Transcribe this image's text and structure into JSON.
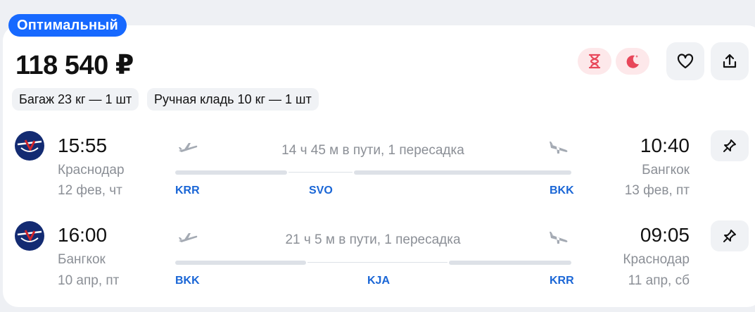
{
  "badge": "Оптимальный",
  "price": "118 540 ₽",
  "baggage": [
    "Багаж 23 кг — 1 шт",
    "Ручная кладь 10 кг — 1 шт"
  ],
  "icons": {
    "hourglass": "hourglass-icon",
    "night": "moon-icon",
    "favorite": "heart-icon",
    "share": "share-icon",
    "pin": "pin-icon",
    "airline": "airline-logo"
  },
  "colors": {
    "accent": "#1769ff",
    "airport_code": "#1a66d6",
    "warning_bg": "#fde8ea",
    "warning_icon": "#e8475a",
    "airline_logo": "#132b72"
  },
  "flights": [
    {
      "dep_time": "15:55",
      "dep_city": "Краснодар",
      "dep_date": "12 фев, чт",
      "duration": "14 ч 45 м в пути, 1 пересадка",
      "arr_time": "10:40",
      "arr_city": "Бангкок",
      "arr_date": "13 фев, пт",
      "codes": [
        "KRR",
        "SVO",
        "BKK"
      ]
    },
    {
      "dep_time": "16:00",
      "dep_city": "Бангкок",
      "dep_date": "10 апр, пт",
      "duration": "21 ч 5 м в пути, 1 пересадка",
      "arr_time": "09:05",
      "arr_city": "Краснодар",
      "arr_date": "11 апр, сб",
      "codes": [
        "BKK",
        "KJA",
        "KRR"
      ]
    }
  ]
}
